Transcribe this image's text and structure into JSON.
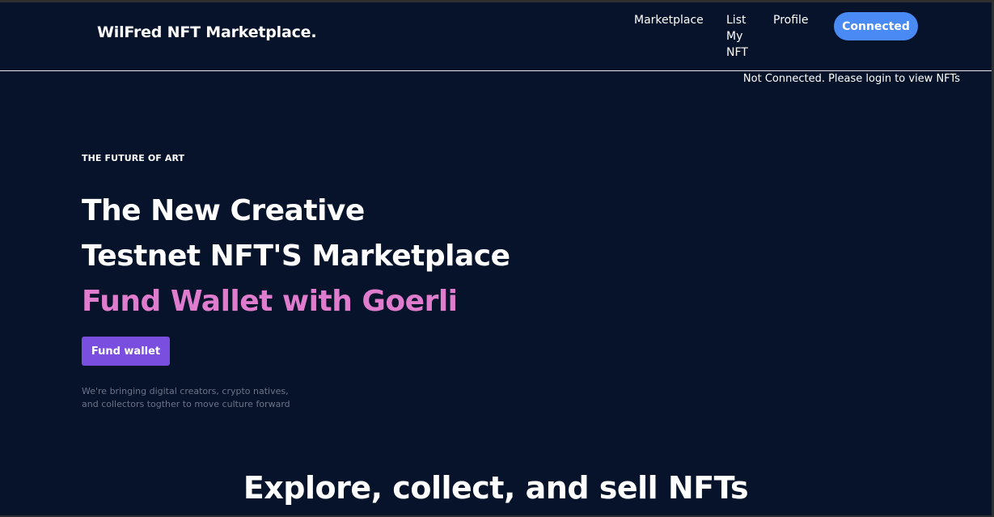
{
  "navbar": {
    "brand": "WilFred NFT Marketplace.",
    "links": {
      "marketplace": "Marketplace",
      "list_line1": "List",
      "list_line2": "My",
      "list_line3": "NFT",
      "profile": "Profile"
    },
    "connect_label": "Connected"
  },
  "status_message": "Not Connected. Please login to view NFTs",
  "hero": {
    "eyebrow": "THE FUTURE OF ART",
    "title_line1": "The New Creative",
    "title_line2": "Testnet NFT'S Marketplace",
    "title_accent": "Fund Wallet with Goerli",
    "fund_button": "Fund wallet",
    "description_line1": "We're bringing digital creators, crypto natives,",
    "description_line2": "and collectors togther to move culture forward"
  },
  "section": {
    "title": "Explore, collect, and sell NFTs"
  },
  "colors": {
    "background": "#07132b",
    "connect_button": "#4a8af4",
    "fund_button": "#7a4fe0",
    "accent_text": "#e07ccd"
  }
}
